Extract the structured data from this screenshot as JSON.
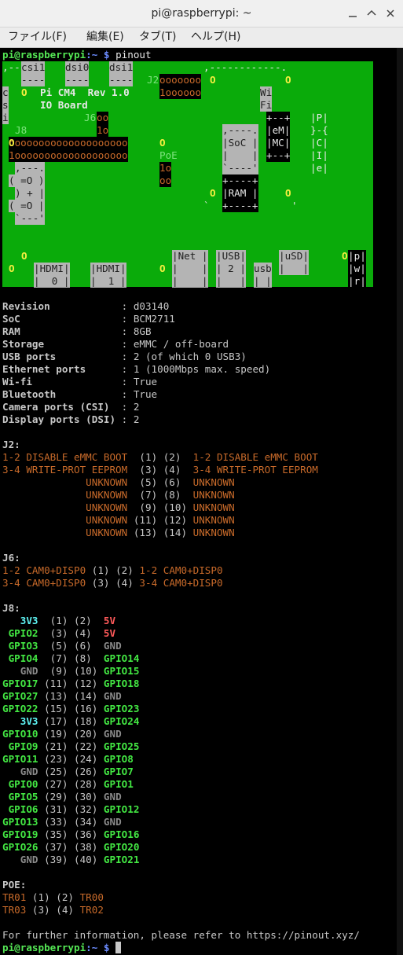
{
  "window": {
    "title": "pi@raspberrypi: ~",
    "buttons": [
      "minimize-icon",
      "maximize-icon",
      "close-icon"
    ]
  },
  "menu": [
    "ファイル(F)",
    "編集(E)",
    "タブ(T)",
    "ヘルプ(H)"
  ],
  "prompt": {
    "user_host": "pi@raspberrypi",
    "path": ":~ ",
    "symbol": "$",
    "command": " pinout"
  },
  "board": {
    "csi1_top": "csi1",
    "dsi0": "dsi0",
    "dsi1": "dsi1",
    "j2_label": "J2",
    "c_s_i": [
      "c",
      "s",
      "i"
    ],
    "title1": "Pi CM4  Rev 1.0",
    "title2": "IO Board",
    "j6_label": "J6",
    "j8_label": "J8",
    "poe_label": "PoE",
    "soc": "SoC",
    "wifi1": "Wi",
    "wifi2": "Fi",
    "emmc": [
      "eM",
      "MC"
    ],
    "pcie": [
      "P",
      "-{",
      "C",
      "I",
      "e"
    ],
    "ram": "RAM",
    "hdmi0": [
      "HDMI",
      "0"
    ],
    "hdmi1": [
      "HDMI",
      "1"
    ],
    "net": "Net",
    "usb2": [
      "USB",
      "2"
    ],
    "usb_small": "usb",
    "usd": "uSD",
    "pwr": [
      "p",
      "w",
      "r"
    ]
  },
  "info": [
    {
      "k": "Revision           ",
      "v": "d03140"
    },
    {
      "k": "SoC                ",
      "v": "BCM2711"
    },
    {
      "k": "RAM                ",
      "v": "8GB"
    },
    {
      "k": "Storage            ",
      "v": "eMMC / off-board"
    },
    {
      "k": "USB ports          ",
      "v": "2 (of which 0 USB3)"
    },
    {
      "k": "Ethernet ports     ",
      "v": "1 (1000Mbps max. speed)"
    },
    {
      "k": "Wi-fi              ",
      "v": "True"
    },
    {
      "k": "Bluetooth          ",
      "v": "True"
    },
    {
      "k": "Camera ports (CSI) ",
      "v": "2"
    },
    {
      "k": "Display ports (DSI)",
      "v": "2"
    }
  ],
  "j2": {
    "header": "J2:",
    "rows": [
      {
        "l": "1-2 DISABLE eMMC BOOT",
        "p": "  (1) (2)  ",
        "r": "1-2 DISABLE eMMC BOOT"
      },
      {
        "l": "3-4 WRITE-PROT EEPROM",
        "p": "  (3) (4)  ",
        "r": "3-4 WRITE-PROT EEPROM"
      },
      {
        "l": "              UNKNOWN",
        "p": "  (5) (6)  ",
        "r": "UNKNOWN"
      },
      {
        "l": "              UNKNOWN",
        "p": "  (7) (8)  ",
        "r": "UNKNOWN"
      },
      {
        "l": "              UNKNOWN",
        "p": "  (9) (10) ",
        "r": "UNKNOWN"
      },
      {
        "l": "              UNKNOWN",
        "p": " (11) (12) ",
        "r": "UNKNOWN"
      },
      {
        "l": "              UNKNOWN",
        "p": " (13) (14) ",
        "r": "UNKNOWN"
      }
    ]
  },
  "j6": {
    "header": "J6:",
    "rows": [
      {
        "l": "1-2 CAM0+DISP0",
        "p": " (1) (2) ",
        "r": "1-2 CAM0+DISP0"
      },
      {
        "l": "3-4 CAM0+DISP0",
        "p": " (3) (4) ",
        "r": "3-4 CAM0+DISP0"
      }
    ]
  },
  "j8": {
    "header": "J8:",
    "rows": [
      {
        "l": "   3V3",
        "lc": "cy",
        "p": "  (1) (2)  ",
        "r": "5V",
        "rc": "rd"
      },
      {
        "l": " GPIO2",
        "lc": "bg",
        "p": "  (3) (4)  ",
        "r": "5V",
        "rc": "rd"
      },
      {
        "l": " GPIO3",
        "lc": "bg",
        "p": "  (5) (6)  ",
        "r": "GND",
        "rc": "dg"
      },
      {
        "l": " GPIO4",
        "lc": "bg",
        "p": "  (7) (8)  ",
        "r": "GPIO14",
        "rc": "bg"
      },
      {
        "l": "   GND",
        "lc": "dg",
        "p": "  (9) (10) ",
        "r": "GPIO15",
        "rc": "bg"
      },
      {
        "l": "GPIO17",
        "lc": "bg",
        "p": " (11) (12) ",
        "r": "GPIO18",
        "rc": "bg"
      },
      {
        "l": "GPIO27",
        "lc": "bg",
        "p": " (13) (14) ",
        "r": "GND",
        "rc": "dg"
      },
      {
        "l": "GPIO22",
        "lc": "bg",
        "p": " (15) (16) ",
        "r": "GPIO23",
        "rc": "bg"
      },
      {
        "l": "   3V3",
        "lc": "cy",
        "p": " (17) (18) ",
        "r": "GPIO24",
        "rc": "bg"
      },
      {
        "l": "GPIO10",
        "lc": "bg",
        "p": " (19) (20) ",
        "r": "GND",
        "rc": "dg"
      },
      {
        "l": " GPIO9",
        "lc": "bg",
        "p": " (21) (22) ",
        "r": "GPIO25",
        "rc": "bg"
      },
      {
        "l": "GPIO11",
        "lc": "bg",
        "p": " (23) (24) ",
        "r": "GPIO8",
        "rc": "bg"
      },
      {
        "l": "   GND",
        "lc": "dg",
        "p": " (25) (26) ",
        "r": "GPIO7",
        "rc": "bg"
      },
      {
        "l": " GPIO0",
        "lc": "bg",
        "p": " (27) (28) ",
        "r": "GPIO1",
        "rc": "bg"
      },
      {
        "l": " GPIO5",
        "lc": "bg",
        "p": " (29) (30) ",
        "r": "GND",
        "rc": "dg"
      },
      {
        "l": " GPIO6",
        "lc": "bg",
        "p": " (31) (32) ",
        "r": "GPIO12",
        "rc": "bg"
      },
      {
        "l": "GPIO13",
        "lc": "bg",
        "p": " (33) (34) ",
        "r": "GND",
        "rc": "dg"
      },
      {
        "l": "GPIO19",
        "lc": "bg",
        "p": " (35) (36) ",
        "r": "GPIO16",
        "rc": "bg"
      },
      {
        "l": "GPIO26",
        "lc": "bg",
        "p": " (37) (38) ",
        "r": "GPIO20",
        "rc": "bg"
      },
      {
        "l": "   GND",
        "lc": "dg",
        "p": " (39) (40) ",
        "r": "GPIO21",
        "rc": "bg"
      }
    ]
  },
  "poe": {
    "header": "POE:",
    "rows": [
      {
        "l": "TR01",
        "p": " (1) (2) ",
        "r": "TR00"
      },
      {
        "l": "TR03",
        "p": " (3) (4) ",
        "r": "TR02"
      }
    ]
  },
  "footer": "For further information, please refer to https://pinout.xyz/",
  "colors": {
    "board_green": "#0aab0a",
    "prompt_green": "#55e855",
    "prompt_blue": "#6c8cff",
    "jumper_orange": "#c86a2a"
  }
}
